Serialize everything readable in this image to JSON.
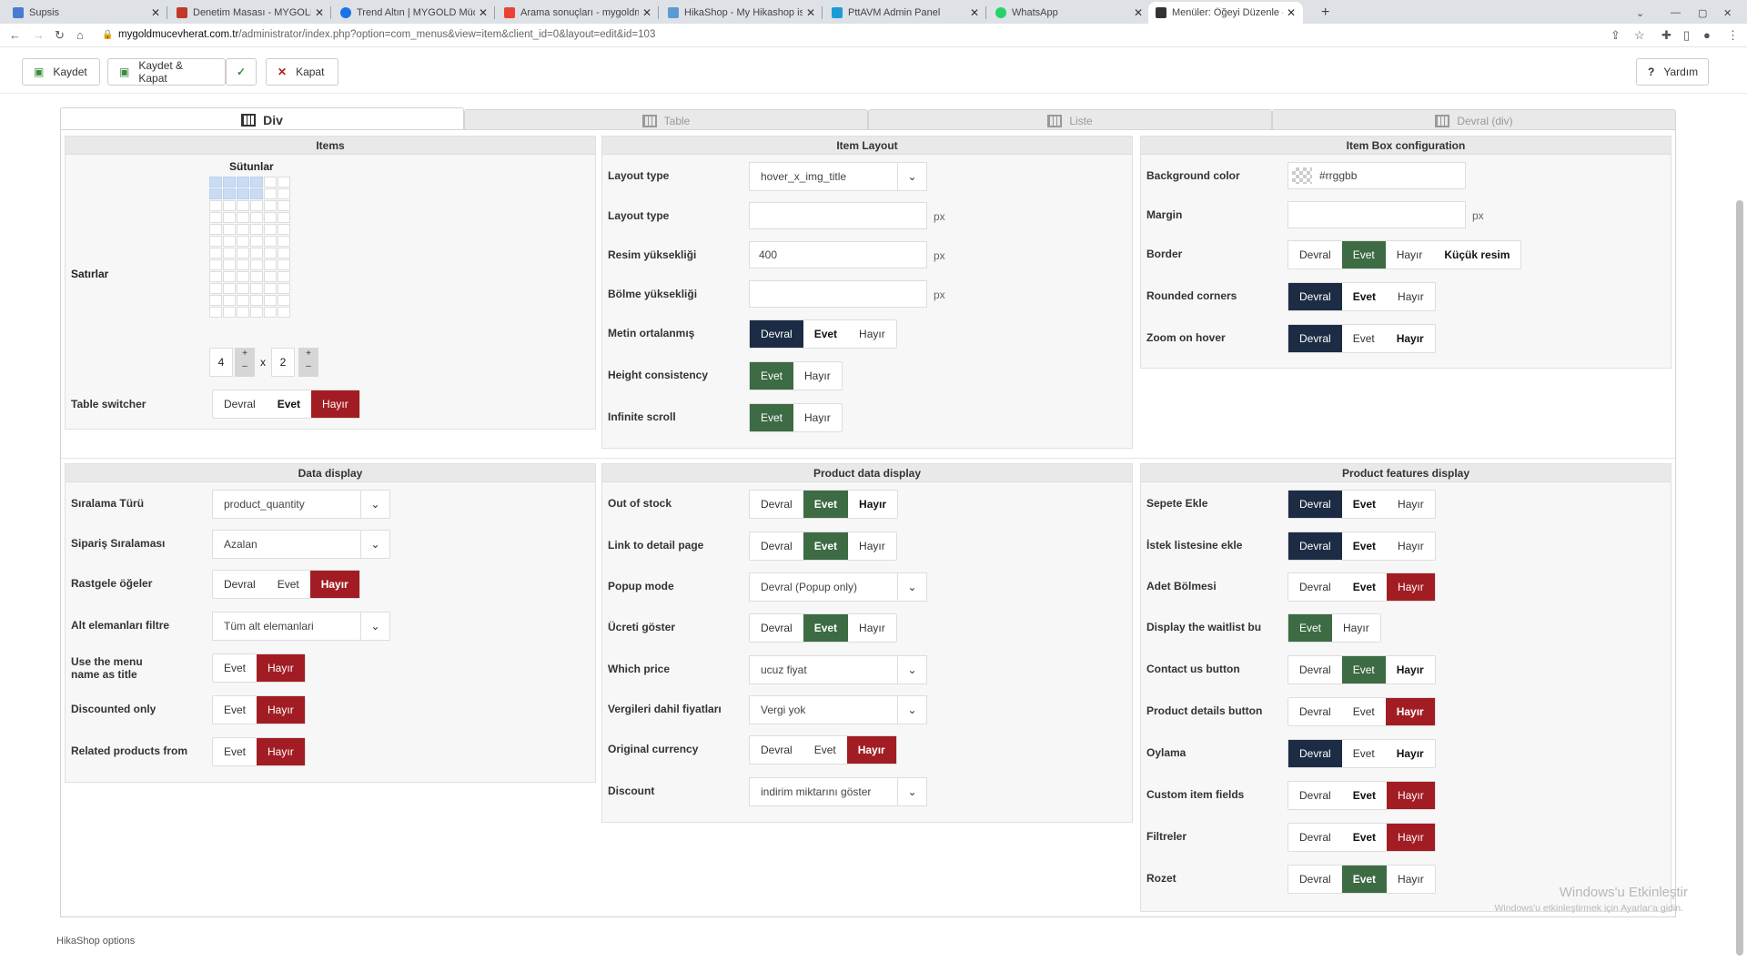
{
  "browser": {
    "tabs": [
      {
        "title": "Supsis",
        "color": "#4a7bd0"
      },
      {
        "title": "Denetim Masası - MYGOLD Mücevherat",
        "color": "#c0392b"
      },
      {
        "title": "Trend Altın | MYGOLD Mücevherat",
        "color": "#1a73e8"
      },
      {
        "title": "Arama sonuçları - mygoldmucevherat",
        "color": "#ea4335"
      },
      {
        "title": "HikaShop - My Hikashop is displayed",
        "color": "#5a9bd5"
      },
      {
        "title": "PttAVM Admin Panel",
        "color": "#1c9bd7"
      },
      {
        "title": "WhatsApp",
        "color": "#25d366"
      },
      {
        "title": "Menüler: Öğeyi Düzenle - MYGOLD",
        "color": "#333333"
      }
    ],
    "url_host": "mygoldmucevherat.com.tr",
    "url_path": "/administrator/index.php?option=com_menus&view=item&client_id=0&layout=edit&id=103"
  },
  "toolbar": {
    "save": "Kaydet",
    "save_close": "Kaydet & Kapat",
    "close": "Kapat",
    "help": "Yardım"
  },
  "view_tabs": [
    "Div",
    "Table",
    "Liste",
    "Devral (div)"
  ],
  "items_panel": {
    "title": "Items",
    "columns_label": "Sütunlar",
    "rows_label": "Satırlar",
    "rows_value": "4",
    "cols_value": "2",
    "times": "x",
    "plus": "+",
    "minus": "–",
    "table_switcher_label": "Table switcher",
    "table_switcher": [
      "Devral",
      "Evet",
      "Hayır"
    ]
  },
  "item_layout": {
    "title": "Item Layout",
    "layout_type_label": "Layout type",
    "layout_type_value": "hover_x_img_title",
    "layout_type2_label": "Layout type",
    "px": "px",
    "image_height_label": "Resim yüksekliği",
    "image_height_value": "400",
    "section_height_label": "Bölme yüksekliği",
    "text_center_label": "Metin ortalanmış",
    "text_center": [
      "Devral",
      "Evet",
      "Hayır"
    ],
    "height_consistency_label": "Height consistency",
    "height_consistency": [
      "Evet",
      "Hayır"
    ],
    "infinite_scroll_label": "Infinite scroll",
    "infinite_scroll": [
      "Evet",
      "Hayır"
    ]
  },
  "item_box": {
    "title": "Item Box configuration",
    "bg_color_label": "Background color",
    "bg_color_value": "#rrggbb",
    "margin_label": "Margin",
    "px": "px",
    "border_label": "Border",
    "border": [
      "Devral",
      "Evet",
      "Hayır",
      "Küçük resim"
    ],
    "rounded_label": "Rounded corners",
    "rounded": [
      "Devral",
      "Evet",
      "Hayır"
    ],
    "zoom_label": "Zoom on hover",
    "zoom": [
      "Devral",
      "Evet",
      "Hayır"
    ]
  },
  "data_display": {
    "title": "Data display",
    "sort_type_label": "Sıralama Türü",
    "sort_type_value": "product_quantity",
    "order_label": "Sipariş Sıralaması",
    "order_value": "Azalan",
    "random_label": "Rastgele öğeler",
    "random": [
      "Devral",
      "Evet",
      "Hayır"
    ],
    "subfilter_label": "Alt elemanları filtre",
    "subfilter_value": "Tüm alt elemanlari",
    "menu_title_label_1": "Use the menu",
    "menu_title_label_2": "name as title",
    "menu_title": [
      "Evet",
      "Hayır"
    ],
    "discounted_label": "Discounted only",
    "discounted": [
      "Evet",
      "Hayır"
    ],
    "related_label": "Related products from",
    "related": [
      "Evet",
      "Hayır"
    ]
  },
  "product_data": {
    "title": "Product data display",
    "out_of_stock_label": "Out of stock",
    "out_of_stock": [
      "Devral",
      "Evet",
      "Hayır"
    ],
    "link_detail_label": "Link to detail page",
    "link_detail": [
      "Devral",
      "Evet",
      "Hayır"
    ],
    "popup_label": "Popup mode",
    "popup_value": "Devral (Popup only)",
    "price_show_label": "Ücreti göster",
    "price_show": [
      "Devral",
      "Evet",
      "Hayır"
    ],
    "which_price_label": "Which price",
    "which_price_value": "ucuz fiyat",
    "tax_label": "Vergileri dahil fiyatları",
    "tax_value": "Vergi yok",
    "orig_currency_label": "Original currency",
    "orig_currency": [
      "Devral",
      "Evet",
      "Hayır"
    ],
    "discount_label": "Discount",
    "discount_value": "indirim miktarını göster"
  },
  "product_features": {
    "title": "Product features display",
    "add_cart_label": "Sepete Ekle",
    "add_cart": [
      "Devral",
      "Evet",
      "Hayır"
    ],
    "wishlist_label": "İstek listesine ekle",
    "wishlist": [
      "Devral",
      "Evet",
      "Hayır"
    ],
    "qty_label": "Adet Bölmesi",
    "qty": [
      "Devral",
      "Evet",
      "Hayır"
    ],
    "waitlist_label": "Display the waitlist bu",
    "waitlist": [
      "Evet",
      "Hayır"
    ],
    "contact_label": "Contact us button",
    "contact": [
      "Devral",
      "Evet",
      "Hayır"
    ],
    "details_label": "Product details button",
    "details": [
      "Devral",
      "Evet",
      "Hayır"
    ],
    "vote_label": "Oylama",
    "vote": [
      "Devral",
      "Evet",
      "Hayır"
    ],
    "custom_label": "Custom item fields",
    "custom": [
      "Devral",
      "Evet",
      "Hayır"
    ],
    "filters_label": "Filtreler",
    "filters": [
      "Devral",
      "Evet",
      "Hayır"
    ],
    "badge_label": "Rozet",
    "badge": [
      "Devral",
      "Evet",
      "Hayır"
    ]
  },
  "watermark": {
    "line1": "Windows'u Etkinleştir",
    "line2": "Windows'u etkinleştirmek için Ayarlar'a gidin."
  },
  "footer": "HikaShop options",
  "colors": {
    "dark": "#1c2c44",
    "green": "#3d6b43",
    "red": "#a11d23"
  }
}
